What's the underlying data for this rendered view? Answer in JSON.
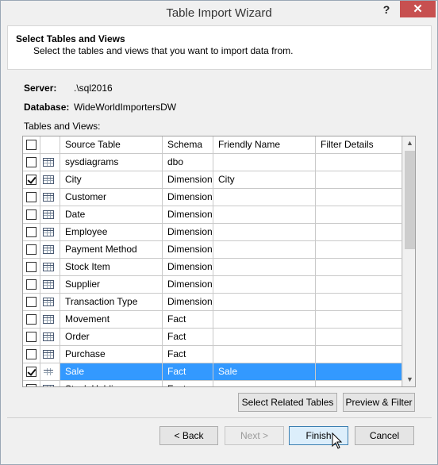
{
  "window": {
    "title": "Table Import Wizard",
    "help_glyph": "?",
    "close_glyph": "✕"
  },
  "header": {
    "title": "Select Tables and Views",
    "description": "Select the tables and views that you want to import data from."
  },
  "server": {
    "label": "Server:",
    "value": ".\\sql2016"
  },
  "database": {
    "label": "Database:",
    "value": "WideWorldImportersDW"
  },
  "tables_label": "Tables and Views:",
  "grid": {
    "columns": [
      "Source Table",
      "Schema",
      "Friendly Name",
      "Filter Details"
    ],
    "rows": [
      {
        "source": "sysdiagrams",
        "schema": "dbo",
        "friendly": "",
        "checked": false
      },
      {
        "source": "City",
        "schema": "Dimension",
        "friendly": "City",
        "checked": true
      },
      {
        "source": "Customer",
        "schema": "Dimension",
        "friendly": "",
        "checked": false
      },
      {
        "source": "Date",
        "schema": "Dimension",
        "friendly": "",
        "checked": false
      },
      {
        "source": "Employee",
        "schema": "Dimension",
        "friendly": "",
        "checked": false
      },
      {
        "source": "Payment Method",
        "schema": "Dimension",
        "friendly": "",
        "checked": false
      },
      {
        "source": "Stock Item",
        "schema": "Dimension",
        "friendly": "",
        "checked": false
      },
      {
        "source": "Supplier",
        "schema": "Dimension",
        "friendly": "",
        "checked": false
      },
      {
        "source": "Transaction Type",
        "schema": "Dimension",
        "friendly": "",
        "checked": false
      },
      {
        "source": "Movement",
        "schema": "Fact",
        "friendly": "",
        "checked": false
      },
      {
        "source": "Order",
        "schema": "Fact",
        "friendly": "",
        "checked": false
      },
      {
        "source": "Purchase",
        "schema": "Fact",
        "friendly": "",
        "checked": false
      },
      {
        "source": "Sale",
        "schema": "Fact",
        "friendly": "Sale",
        "checked": true,
        "selected": true
      },
      {
        "source": "Stock Holding",
        "schema": "Fact",
        "friendly": "",
        "checked": false
      }
    ]
  },
  "buttons": {
    "select_related": "Select Related Tables",
    "preview_filter": "Preview & Filter",
    "back": "< Back",
    "next": "Next >",
    "finish": "Finish",
    "cancel": "Cancel"
  },
  "colors": {
    "selection": "#3399ff",
    "close": "#c75050"
  }
}
